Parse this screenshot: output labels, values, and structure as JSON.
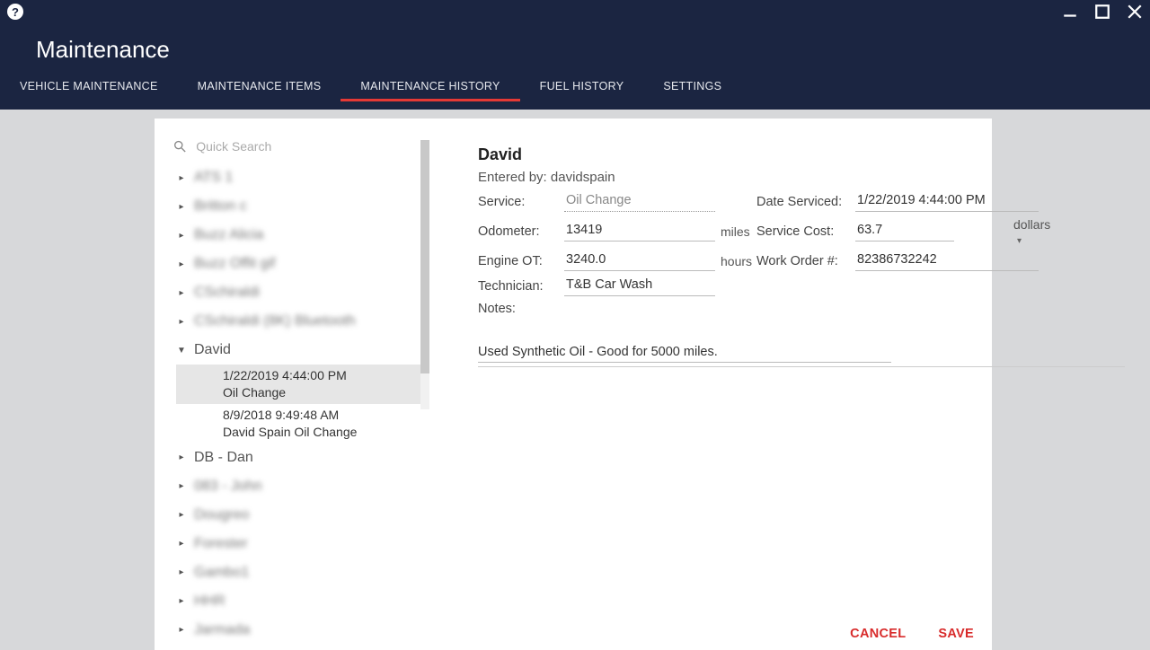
{
  "window": {
    "title": "Maintenance"
  },
  "tabs": {
    "vehicle_maintenance": "VEHICLE MAINTENANCE",
    "maintenance_items": "MAINTENANCE ITEMS",
    "maintenance_history": "MAINTENANCE HISTORY",
    "fuel_history": "FUEL HISTORY",
    "settings": "SETTINGS"
  },
  "search": {
    "placeholder": "Quick Search"
  },
  "tree": {
    "blurred": [
      "ATS 1",
      "Britton c",
      "Buzz Alicia",
      "Buzz Offit gif",
      "CSchiraldi",
      "CSchiraldi (8K) Bluetooth"
    ],
    "david_label": "David",
    "david_records": [
      {
        "time": "1/22/2019 4:44:00 PM",
        "desc": "Oil Change"
      },
      {
        "time": "8/9/2018 9:49:48 AM",
        "desc": "David Spain Oil Change"
      }
    ],
    "db_dan": "DB - Dan",
    "blurred2": [
      "083 - John",
      "Dougreo",
      "Forester",
      "Gambo1",
      "HHR",
      "Jarmada"
    ]
  },
  "detail": {
    "title": "David",
    "entered_by_label": "Entered by: ",
    "entered_by_value": "davidspain",
    "labels": {
      "service": "Service:",
      "odometer": "Odometer:",
      "engine_ot": "Engine OT:",
      "technician": "Technician:",
      "notes": "Notes:",
      "date_serviced": "Date Serviced:",
      "service_cost": "Service Cost:",
      "work_order": "Work Order #:"
    },
    "values": {
      "service": "Oil Change",
      "odometer": "13419",
      "engine_ot": "3240.0",
      "technician": "T&B Car Wash",
      "date_serviced": "1/22/2019 4:44:00 PM",
      "service_cost": "63.7",
      "work_order": "82386732242",
      "notes": "Used Synthetic Oil - Good for 5000 miles."
    },
    "units": {
      "miles": "miles",
      "hours": "hours",
      "dollars": "dollars"
    }
  },
  "actions": {
    "cancel": "CANCEL",
    "save": "SAVE"
  }
}
